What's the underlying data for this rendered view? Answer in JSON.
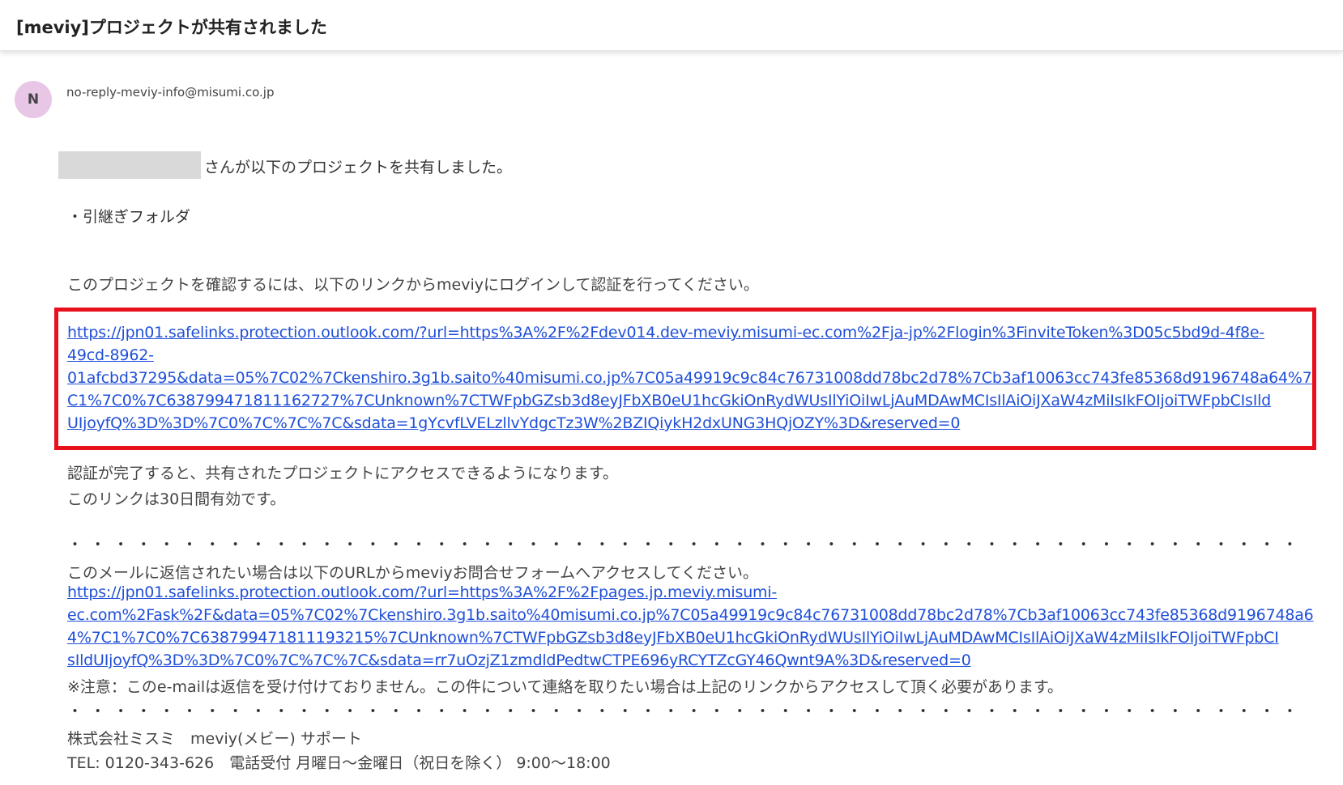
{
  "subject": "[meviy]プロジェクトが共有されました",
  "sender": {
    "avatar_initial": "N",
    "address": "no-reply-meviy-info@misumi.co.jp"
  },
  "body": {
    "shared_by_suffix": "さんが以下のプロジェクトを共有しました。",
    "project_item": "・引継ぎフォルダ",
    "instruction": "このプロジェクトを確認するには、以下のリンクからmeviyにログインして認証を行ってください。",
    "login_link_lines": [
      "https://jpn01.safelinks.protection.outlook.com/?url=https%3A%2F%2Fdev014.dev-meviy.misumi-ec.com%2Fja-jp%2Flogin%3FinviteToken%3D05c5bd9d-4f8e-",
      "49cd-8962-",
      "01afcbd37295&data=05%7C02%7Ckenshiro.3g1b.saito%40misumi.co.jp%7C05a49919c9c84c76731008dd78bc2d78%7Cb3af10063cc743fe85368d9196748a64%7",
      "C1%7C0%7C638799471811162727%7CUnknown%7CTWFpbGZsb3d8eyJFbXB0eU1hcGkiOnRydWUsIlYiOiIwLjAuMDAwMCIsIlAiOiJXaW4zMiIsIkFOIjoiTWFpbCIsIld",
      "UIjoyfQ%3D%3D%7C0%7C%7C%7C&sdata=1gYcvfLVELzllvYdgcTz3W%2BZIQiykH2dxUNG3HQjOZY%3D&reserved=0"
    ],
    "after_auth": "認証が完了すると、共有されたプロジェクトにアクセスできるようになります。",
    "validity": "このリンクは30日間有効です。",
    "separator": "・・・・・・・・・・・・・・・・・・・・・・・・・・・・・・・・・・・・・・・・・・・・・・・・・・・・・・・・・・・・・・・・・・・・・・・・・・・・・・・",
    "reply_note": "このメールに返信されたい場合は以下のURLからmeviyお問合せフォームへアクセスしてください。",
    "contact_link_lines": [
      "https://jpn01.safelinks.protection.outlook.com/?url=https%3A%2F%2Fpages.jp.meviy.misumi-",
      "ec.com%2Fask%2F&data=05%7C02%7Ckenshiro.3g1b.saito%40misumi.co.jp%7C05a49919c9c84c76731008dd78bc2d78%7Cb3af10063cc743fe85368d9196748a6",
      "4%7C1%7C0%7C638799471811193215%7CUnknown%7CTWFpbGZsb3d8eyJFbXB0eU1hcGkiOnRydWUsIlYiOiIwLjAuMDAwMCIsIlAiOiJXaW4zMiIsIkFOIjoiTWFpbCI",
      "sIldUIjoyfQ%3D%3D%7C0%7C%7C%7C&sdata=rr7uOzjZ1zmdldPedtwCTPE696yRCYTZcGY46Qwnt9A%3D&reserved=0"
    ],
    "notice": "※注意：このe-mailは返信を受け付けておりません。この件について連絡を取りたい場合は上記のリンクからアクセスして頂く必要があります。",
    "company": "株式会社ミスミ　meviy(メビー) サポート",
    "tel": "TEL: 0120-343-626　電話受付 月曜日～金曜日（祝日を除く） 9:00～18:00"
  },
  "colors": {
    "link": "#1f4fd8",
    "highlight_border": "#e8101c",
    "avatar_bg": "#e8c6e6"
  }
}
